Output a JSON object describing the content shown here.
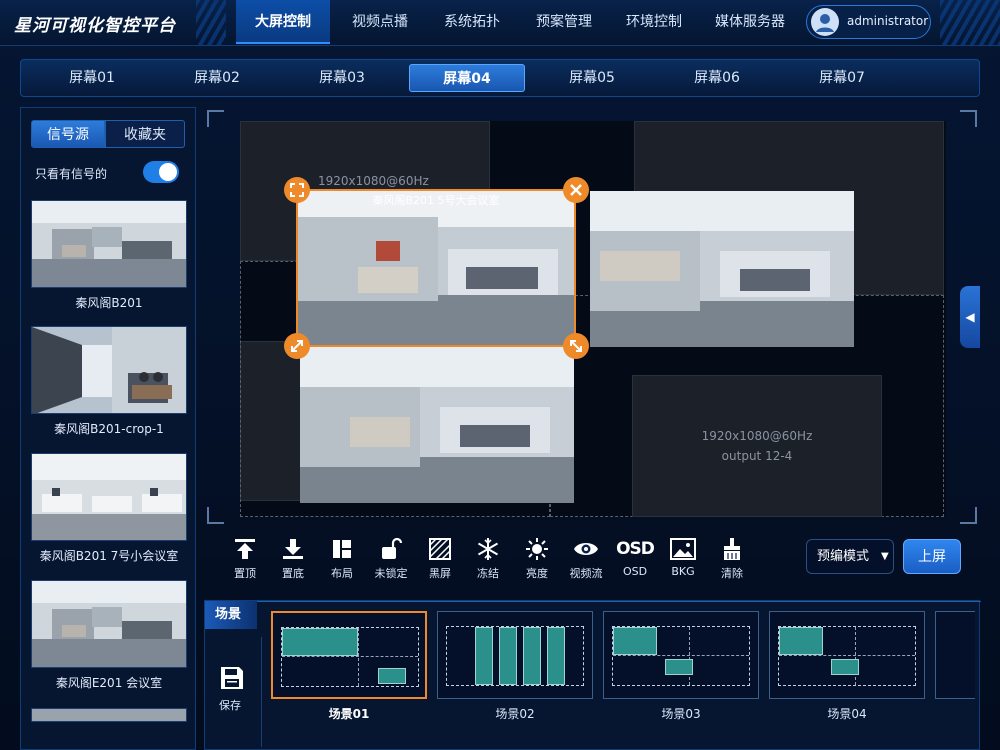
{
  "app": {
    "title": "星河可视化智控平台"
  },
  "nav": {
    "items": [
      "大屏控制",
      "视频点播",
      "系统拓扑",
      "预案管理",
      "环境控制",
      "媒体服务器"
    ],
    "active": "大屏控制"
  },
  "user": {
    "name": "administrator"
  },
  "screens": {
    "tabs": [
      "屏幕01",
      "屏幕02",
      "屏幕03",
      "屏幕04",
      "屏幕05",
      "屏幕06",
      "屏幕07"
    ],
    "active": "屏幕04"
  },
  "sidebar": {
    "tabs": [
      "信号源",
      "收藏夹"
    ],
    "active_tab": "信号源",
    "filter_label": "只看有信号的",
    "filter_on": true,
    "sources": [
      {
        "label": "秦风阁B201"
      },
      {
        "label": "秦风阁B201-crop-1"
      },
      {
        "label": "秦风阁B201 7号小会议室"
      },
      {
        "label": "秦风阁E201 会议室"
      }
    ]
  },
  "canvas": {
    "selected_res": "1920x1080@60Hz",
    "selected_title": "秦风阁B201 5号大会议室",
    "empty_res": "1920x1080@60Hz",
    "empty_output": "output 12-4"
  },
  "toolbar": {
    "tools": [
      {
        "icon": "move-top-icon",
        "label": "置顶"
      },
      {
        "icon": "move-bottom-icon",
        "label": "置底"
      },
      {
        "icon": "layout-icon",
        "label": "布局"
      },
      {
        "icon": "unlock-icon",
        "label": "未锁定"
      },
      {
        "icon": "black-screen-icon",
        "label": "黑屏"
      },
      {
        "icon": "freeze-icon",
        "label": "冻结"
      },
      {
        "icon": "brightness-icon",
        "label": "亮度"
      },
      {
        "icon": "eye-icon",
        "label": "视频流"
      },
      {
        "icon": "osd-icon",
        "label": "OSD"
      },
      {
        "icon": "image-icon",
        "label": "BKG"
      },
      {
        "icon": "clear-icon",
        "label": "清除"
      }
    ],
    "mode_value": "预编模式",
    "upload_label": "上屏",
    "osd_text": "OSD"
  },
  "scenes": {
    "title": "场景",
    "save_label": "保存",
    "items": [
      {
        "label": "场景01"
      },
      {
        "label": "场景02"
      },
      {
        "label": "场景03"
      },
      {
        "label": "场景04"
      }
    ],
    "active": "场景01"
  },
  "colors": {
    "accent": "#2f86ee",
    "highlight": "#ef8a2a",
    "teal": "#2b8f8c"
  }
}
